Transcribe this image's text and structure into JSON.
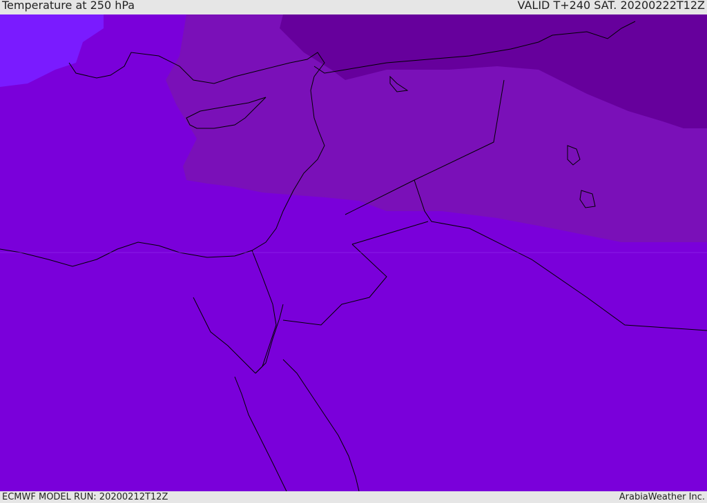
{
  "header": {
    "title": "Temperature at 250 hPa",
    "valid": "VALID T+240 SAT. 20200222T12Z"
  },
  "footer": {
    "model_run": "ECMWF MODEL RUN: 20200212T12Z",
    "credit": "ArabiaWeather Inc."
  },
  "map": {
    "colors": {
      "base": "#7a00da",
      "cold_west": "#7a1bff",
      "band_mid": "#7a10b8",
      "band_dark": "#66009c",
      "coastline": "#000000"
    }
  }
}
